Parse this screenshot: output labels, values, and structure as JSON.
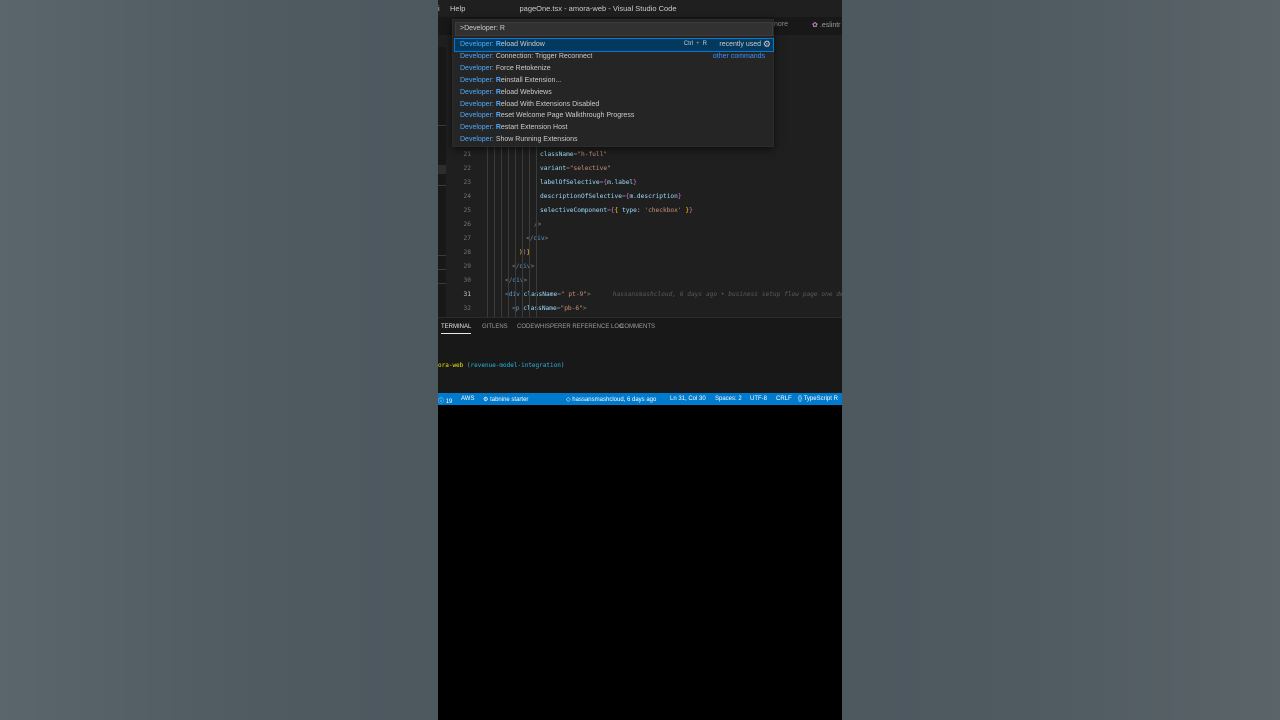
{
  "window": {
    "title": "pageOne.tsx - amora-web - Visual Studio Code",
    "menu_edge": "i",
    "menu_help": "Help"
  },
  "tabs": {
    "partial_tab": "nore",
    "eslint_tab": ".eslintr"
  },
  "command_palette": {
    "input_value": ">Developer: R",
    "items": [
      {
        "category": "Developer:",
        "match": "R",
        "rest": "eload Window",
        "keybinding": [
          "Ctrl",
          "R"
        ],
        "tag": "recently used"
      },
      {
        "category": "Developer:",
        "match": "",
        "rest": "Connection: Trigger Reconnect",
        "tag": "other commands"
      },
      {
        "category": "Developer:",
        "match": "",
        "rest": "Force Retokenize"
      },
      {
        "category": "Developer:",
        "match": "R",
        "rest": "einstall Extension..."
      },
      {
        "category": "Developer:",
        "match": "R",
        "rest": "eload Webviews"
      },
      {
        "category": "Developer:",
        "match": "R",
        "rest": "eload With Extensions Disabled"
      },
      {
        "category": "Developer:",
        "match": "R",
        "rest": "eset Welcome Page Walkthrough Progress"
      },
      {
        "category": "Developer:",
        "match": "R",
        "rest": "estart Extension Host"
      },
      {
        "category": "Developer:",
        "match": "",
        "rest": "Show Running Extensions"
      }
    ]
  },
  "editor": {
    "lines": [
      {
        "n": "21",
        "parts": [
          [
            "t-attr",
            "className"
          ],
          [
            "t-punc",
            "="
          ],
          [
            "t-str",
            "\"h-full\""
          ]
        ]
      },
      {
        "n": "22",
        "parts": [
          [
            "t-attr",
            "variant"
          ],
          [
            "t-punc",
            "="
          ],
          [
            "t-str",
            "\"selective\""
          ]
        ]
      },
      {
        "n": "23",
        "parts": [
          [
            "t-attr",
            "labelOfSelective"
          ],
          [
            "t-punc",
            "="
          ],
          [
            "t-brace",
            "{"
          ],
          [
            "t-var",
            "m.label"
          ],
          [
            "t-brace",
            "}"
          ]
        ]
      },
      {
        "n": "24",
        "parts": [
          [
            "t-attr",
            "descriptionOfSelective"
          ],
          [
            "t-punc",
            "="
          ],
          [
            "t-brace",
            "{"
          ],
          [
            "t-var",
            "m.description"
          ],
          [
            "t-brace",
            "}"
          ]
        ]
      },
      {
        "n": "25",
        "parts": [
          [
            "t-attr",
            "selectiveComponent"
          ],
          [
            "t-punc",
            "="
          ],
          [
            "t-brace",
            "{"
          ],
          [
            "t-brace2",
            "{ "
          ],
          [
            "t-attr",
            "type"
          ],
          [
            "t-plain",
            ": "
          ],
          [
            "t-str",
            "'checkbox'"
          ],
          [
            "t-brace2",
            " }"
          ],
          [
            "t-brace",
            "}"
          ]
        ]
      },
      {
        "n": "26",
        "parts": [
          [
            "t-punc",
            "/>"
          ]
        ]
      },
      {
        "n": "27",
        "parts": [
          [
            "t-punc",
            "</"
          ],
          [
            "t-tag",
            "div"
          ],
          [
            "t-punc",
            ">"
          ]
        ]
      },
      {
        "n": "28",
        "parts": [
          [
            "t-brace2",
            ")"
          ],
          [
            "t-brace",
            ")"
          ],
          [
            "t-brace2",
            "}"
          ]
        ]
      },
      {
        "n": "29",
        "parts": [
          [
            "t-punc",
            "</"
          ],
          [
            "t-tag",
            "div"
          ],
          [
            "t-punc",
            ">"
          ]
        ]
      },
      {
        "n": "30",
        "parts": [
          [
            "t-punc",
            "</"
          ],
          [
            "t-tag",
            "div"
          ],
          [
            "t-punc",
            ">"
          ]
        ]
      },
      {
        "n": "31",
        "parts": [
          [
            "t-punc",
            "<"
          ],
          [
            "t-tag",
            "div"
          ],
          [
            "t-plain",
            " "
          ],
          [
            "t-attr",
            "className"
          ],
          [
            "t-punc",
            "="
          ],
          [
            "t-str",
            "\" pt-9\""
          ],
          [
            "t-punc",
            ">"
          ]
        ]
      },
      {
        "n": "32",
        "parts": [
          [
            "t-punc",
            "<"
          ],
          [
            "t-tag",
            "p"
          ],
          [
            "t-plain",
            " "
          ],
          [
            "t-attr",
            "className"
          ],
          [
            "t-punc",
            "="
          ],
          [
            "t-str",
            "\"pb-6\""
          ],
          [
            "t-punc",
            ">"
          ]
        ]
      }
    ],
    "blame": "hassansmashcloud, 6 days ago • business setup flow page one design"
  },
  "panel": {
    "tabs": [
      "TERMINAL",
      "GITLENS",
      "CODEWHISPERER REFERENCE LOG",
      "COMMENTS"
    ],
    "active_tab": "TERMINAL",
    "terminal_folder": "ora-web",
    "terminal_branch": " (revenue-model-integration)"
  },
  "statusbar": {
    "problems": "19",
    "aws": "AWS",
    "tabnine": "tabnine starter",
    "blame": "hassansmashcloud, 6 days ago",
    "position": "Ln 31, Col 30",
    "spaces": "Spaces: 2",
    "encoding": "UTF-8",
    "eol": "CRLF",
    "language": "TypeScript R"
  },
  "colors": {
    "accent": "#007acc",
    "selection": "#04395e",
    "highlight": "#4daafc"
  }
}
